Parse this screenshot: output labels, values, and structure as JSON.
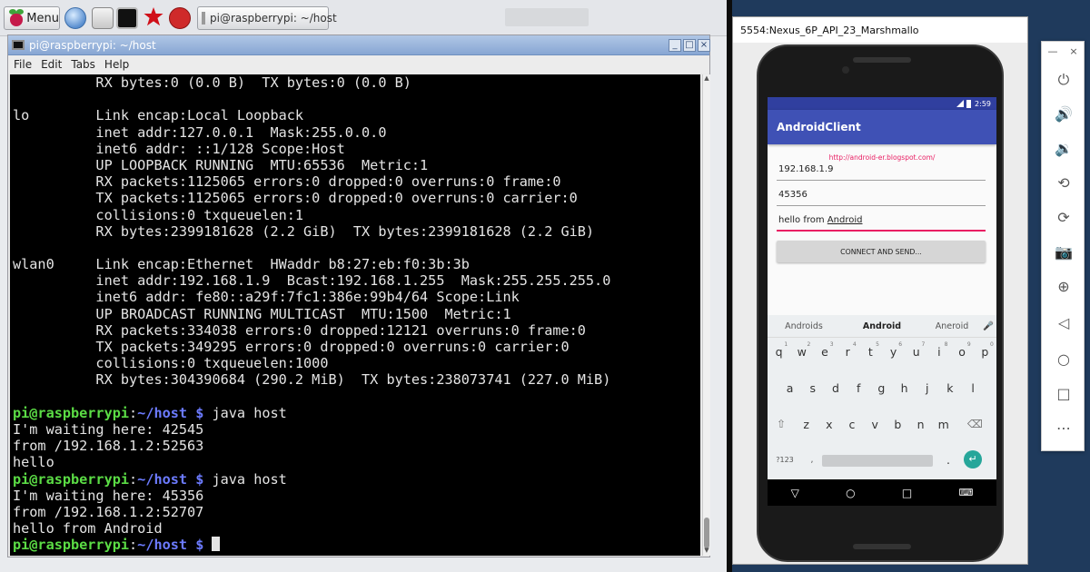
{
  "pi_taskbar": {
    "menu_label": "Menu",
    "task_label": "pi@raspberrypi: ~/host"
  },
  "terminal": {
    "title": "pi@raspberrypi: ~/host",
    "menu": [
      "File",
      "Edit",
      "Tabs",
      "Help"
    ],
    "output": [
      "          RX bytes:0 (0.0 B)  TX bytes:0 (0.0 B)",
      "",
      "lo        Link encap:Local Loopback",
      "          inet addr:127.0.0.1  Mask:255.0.0.0",
      "          inet6 addr: ::1/128 Scope:Host",
      "          UP LOOPBACK RUNNING  MTU:65536  Metric:1",
      "          RX packets:1125065 errors:0 dropped:0 overruns:0 frame:0",
      "          TX packets:1125065 errors:0 dropped:0 overruns:0 carrier:0",
      "          collisions:0 txqueuelen:1",
      "          RX bytes:2399181628 (2.2 GiB)  TX bytes:2399181628 (2.2 GiB)",
      "",
      "wlan0     Link encap:Ethernet  HWaddr b8:27:eb:f0:3b:3b",
      "          inet addr:192.168.1.9  Bcast:192.168.1.255  Mask:255.255.255.0",
      "          inet6 addr: fe80::a29f:7fc1:386e:99b4/64 Scope:Link",
      "          UP BROADCAST RUNNING MULTICAST  MTU:1500  Metric:1",
      "          RX packets:334038 errors:0 dropped:12121 overruns:0 frame:0",
      "          TX packets:349295 errors:0 dropped:0 overruns:0 carrier:0",
      "          collisions:0 txqueuelen:1000",
      "          RX bytes:304390684 (290.2 MiB)  TX bytes:238073741 (227.0 MiB)",
      ""
    ],
    "prompt_user": "pi@raspberrypi",
    "prompt_path": "~/host",
    "prompt_sep": ":",
    "prompt_end": " $ ",
    "session": [
      {
        "command": "java host",
        "output": [
          "I'm waiting here: 42545",
          "from /192.168.1.2:52563",
          "hello"
        ]
      },
      {
        "command": "java host",
        "output": [
          "I'm waiting here: 45356",
          "from /192.168.1.2:52707",
          "hello from Android"
        ]
      }
    ]
  },
  "emulator": {
    "window_title": "5554:Nexus_6P_API_23_Marshmallo",
    "status_time": "2:59",
    "app_title": "AndroidClient",
    "link": "http://android-er.blogspot.com/",
    "ip_value": "192.168.1.9",
    "port_value": "45356",
    "message_prefix": "hello from ",
    "message_word": "Android",
    "connect_label": "CONNECT AND SEND...",
    "suggestions": [
      "Androids",
      "Android",
      "Aneroid"
    ],
    "row1": [
      "q",
      "w",
      "e",
      "r",
      "t",
      "y",
      "u",
      "i",
      "o",
      "p"
    ],
    "row1_hints": [
      "1",
      "2",
      "3",
      "4",
      "5",
      "6",
      "7",
      "8",
      "9",
      "0"
    ],
    "row2": [
      "a",
      "s",
      "d",
      "f",
      "g",
      "h",
      "j",
      "k",
      "l"
    ],
    "row3": [
      "z",
      "x",
      "c",
      "v",
      "b",
      "n",
      "m"
    ],
    "sym_label": "?123",
    "period": ".",
    "toolbar_top": [
      "—",
      "×"
    ]
  },
  "colors": {
    "prompt_user": "#5bdc45",
    "prompt_path": "#6c7bff",
    "app_bar": "#3f51b5",
    "accent": "#e91e63",
    "enter_key": "#26a69a"
  }
}
